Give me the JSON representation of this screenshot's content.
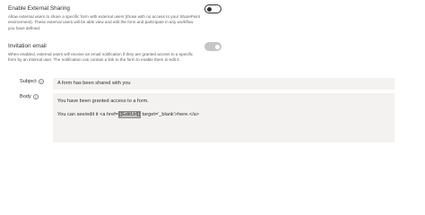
{
  "external_sharing": {
    "title": "Enable External Sharing",
    "description": "Allow external users to share a specific form with external users (those with no access to your SharePoint environment). These external users will be able view and edit the form and participate in any workflow you have defined.",
    "toggle_state": "off"
  },
  "invitation_email": {
    "title": "Invitation email",
    "description": "When enabled, external users will receive an email notification if they are granted access to a specific form by an internal user. The notification can contain a link to the form to enable them to edit it.",
    "toggle_state": "disabled"
  },
  "subject": {
    "label": "Subject",
    "value": "A form has been shared with you"
  },
  "body": {
    "label": "Body",
    "line1": "You have been granted access to a form.",
    "line2_prefix": "You can see/edit it <a href='",
    "line2_token": "[[EditUrl]]",
    "line2_suffix": "' target='_blank'>here.</a>"
  },
  "colors": {
    "field_background": "#f3f2f1",
    "toggle_disabled": "#c8c6c4",
    "text_primary": "#323130",
    "text_secondary": "#605e5c"
  }
}
